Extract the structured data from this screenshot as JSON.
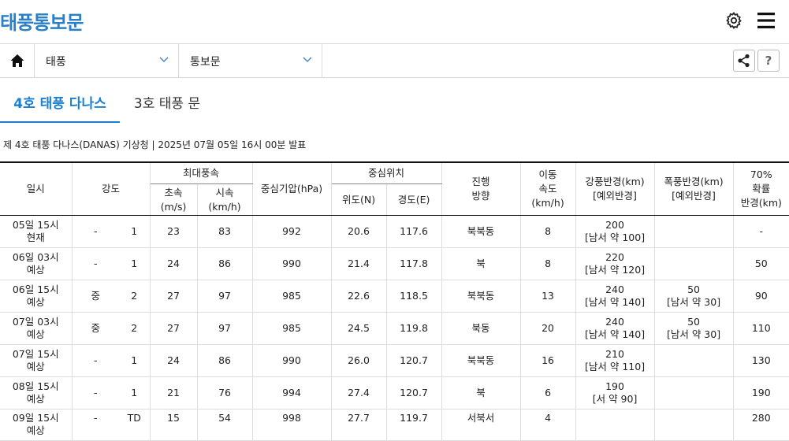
{
  "app": {
    "title": "태풍통보문"
  },
  "nav": {
    "dropdown1": "태풍",
    "dropdown2": "통보문",
    "help": "?"
  },
  "tabs": [
    {
      "label": "4호 태풍 다나스"
    },
    {
      "label": "3호 태풍 문"
    }
  ],
  "report_info": "제 4호 태풍 다나스(DANAS) 기상청 | 2025년 07월 05일 16시 00분 발표",
  "table": {
    "headers": {
      "datetime": "일시",
      "intensity": "강도",
      "max_wind": "최대풍속",
      "wind_ms": [
        "초속",
        "(m/s)"
      ],
      "wind_kmh": [
        "시속",
        "(km/h)"
      ],
      "pressure": "중심기압(hPa)",
      "center": "중심위치",
      "lat": "위도(N)",
      "lon": "경도(E)",
      "direction": [
        "진행",
        "방향"
      ],
      "speed": [
        "이동",
        "속도",
        "(km/h)"
      ],
      "gale_radius": [
        "강풍반경(km)",
        "[예외반경]"
      ],
      "storm_radius": [
        "폭풍반경(km)",
        "[예외반경]"
      ],
      "prob_radius": [
        "70%",
        "확률",
        "반경(km)"
      ]
    },
    "rows": [
      {
        "date": "05일 15시",
        "kind": "현재",
        "strength": "-",
        "category": "1",
        "ms": "23",
        "kmh": "83",
        "hpa": "992",
        "lat": "20.6",
        "lon": "117.6",
        "dir": "북북동",
        "spd": "8",
        "gale": "200",
        "gale_ex": "[남서 약 100]",
        "storm": "",
        "storm_ex": "",
        "prob": "-"
      },
      {
        "date": "06일 03시",
        "kind": "예상",
        "strength": "-",
        "category": "1",
        "ms": "24",
        "kmh": "86",
        "hpa": "990",
        "lat": "21.4",
        "lon": "117.8",
        "dir": "북",
        "spd": "8",
        "gale": "220",
        "gale_ex": "[남서 약 120]",
        "storm": "",
        "storm_ex": "",
        "prob": "50"
      },
      {
        "date": "06일 15시",
        "kind": "예상",
        "strength": "중",
        "category": "2",
        "ms": "27",
        "kmh": "97",
        "hpa": "985",
        "lat": "22.6",
        "lon": "118.5",
        "dir": "북북동",
        "spd": "13",
        "gale": "240",
        "gale_ex": "[남서 약 140]",
        "storm": "50",
        "storm_ex": "[남서 약 30]",
        "prob": "90"
      },
      {
        "date": "07일 03시",
        "kind": "예상",
        "strength": "중",
        "category": "2",
        "ms": "27",
        "kmh": "97",
        "hpa": "985",
        "lat": "24.5",
        "lon": "119.8",
        "dir": "북동",
        "spd": "20",
        "gale": "240",
        "gale_ex": "[남서 약 140]",
        "storm": "50",
        "storm_ex": "[남서 약 30]",
        "prob": "110"
      },
      {
        "date": "07일 15시",
        "kind": "예상",
        "strength": "-",
        "category": "1",
        "ms": "24",
        "kmh": "86",
        "hpa": "990",
        "lat": "26.0",
        "lon": "120.7",
        "dir": "북북동",
        "spd": "16",
        "gale": "210",
        "gale_ex": "[남서 약 110]",
        "storm": "",
        "storm_ex": "",
        "prob": "130"
      },
      {
        "date": "08일 15시",
        "kind": "예상",
        "strength": "-",
        "category": "1",
        "ms": "21",
        "kmh": "76",
        "hpa": "994",
        "lat": "27.4",
        "lon": "120.7",
        "dir": "북",
        "spd": "6",
        "gale": "190",
        "gale_ex": "[서 약 90]",
        "storm": "",
        "storm_ex": "",
        "prob": "190"
      },
      {
        "date": "09일 15시",
        "kind": "예상",
        "strength": "-",
        "category": "TD",
        "ms": "15",
        "kmh": "54",
        "hpa": "998",
        "lat": "27.7",
        "lon": "119.7",
        "dir": "서북서",
        "spd": "4",
        "gale": "",
        "gale_ex": "",
        "storm": "",
        "storm_ex": "",
        "prob": "280"
      }
    ]
  }
}
